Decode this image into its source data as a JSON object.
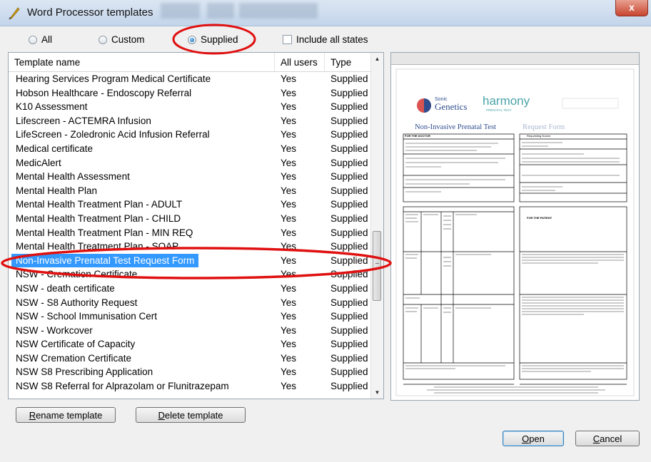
{
  "window": {
    "title": "Word Processor templates",
    "close_glyph": "x"
  },
  "filters": {
    "options": [
      {
        "label": "All",
        "selected": false
      },
      {
        "label": "Custom",
        "selected": false
      },
      {
        "label": "Supplied",
        "selected": true
      }
    ],
    "include_all_states": {
      "label": "Include all states",
      "checked": false
    }
  },
  "table": {
    "columns": [
      "Template name",
      "All users",
      "Type"
    ],
    "rows": [
      {
        "name": "Hearing Services Program Medical Certificate",
        "all_users": "Yes",
        "type": "Supplied"
      },
      {
        "name": "Hobson Healthcare - Endoscopy Referral",
        "all_users": "Yes",
        "type": "Supplied"
      },
      {
        "name": "K10 Assessment",
        "all_users": "Yes",
        "type": "Supplied"
      },
      {
        "name": "Lifescreen - ACTEMRA Infusion",
        "all_users": "Yes",
        "type": "Supplied"
      },
      {
        "name": "LifeScreen - Zoledronic Acid Infusion Referral",
        "all_users": "Yes",
        "type": "Supplied"
      },
      {
        "name": "Medical certificate",
        "all_users": "Yes",
        "type": "Supplied"
      },
      {
        "name": "MedicAlert",
        "all_users": "Yes",
        "type": "Supplied"
      },
      {
        "name": "Mental Health Assessment",
        "all_users": "Yes",
        "type": "Supplied"
      },
      {
        "name": "Mental Health Plan",
        "all_users": "Yes",
        "type": "Supplied"
      },
      {
        "name": "Mental Health Treatment Plan - ADULT",
        "all_users": "Yes",
        "type": "Supplied"
      },
      {
        "name": "Mental Health Treatment Plan - CHILD",
        "all_users": "Yes",
        "type": "Supplied"
      },
      {
        "name": "Mental Health Treatment Plan - MIN REQ",
        "all_users": "Yes",
        "type": "Supplied"
      },
      {
        "name": "Mental Health Treatment Plan - SOAP",
        "all_users": "Yes",
        "type": "Supplied"
      },
      {
        "name": "Non-Invasive Prenatal Test Request Form",
        "all_users": "Yes",
        "type": "Supplied",
        "selected": true
      },
      {
        "name": "NSW - Cremation Certificate",
        "all_users": "Yes",
        "type": "Supplied"
      },
      {
        "name": "NSW - death certificate",
        "all_users": "Yes",
        "type": "Supplied"
      },
      {
        "name": "NSW - S8 Authority Request",
        "all_users": "Yes",
        "type": "Supplied"
      },
      {
        "name": "NSW - School Immunisation Cert",
        "all_users": "Yes",
        "type": "Supplied"
      },
      {
        "name": "NSW - Workcover",
        "all_users": "Yes",
        "type": "Supplied"
      },
      {
        "name": "NSW Certificate of Capacity",
        "all_users": "Yes",
        "type": "Supplied"
      },
      {
        "name": "NSW Cremation Certificate",
        "all_users": "Yes",
        "type": "Supplied"
      },
      {
        "name": "NSW S8 Prescribing Application",
        "all_users": "Yes",
        "type": "Supplied"
      },
      {
        "name": "NSW S8 Referral for Alprazolam or Flunitrazepam",
        "all_users": "Yes",
        "type": "Supplied"
      }
    ]
  },
  "preview": {
    "brand_sonic_line1": "Sonic",
    "brand_sonic_line2": "Genetics",
    "brand_harmony": "harmony",
    "brand_harmony_sub": "PRENATAL TEST",
    "form_title": "Non-Invasive Prenatal Test",
    "form_title_suffix": "Request Form",
    "section_doctor": "FOR THE DOCTOR",
    "section_referring": "Requesting Doctor",
    "section_patient": "FOR THE PATIENT"
  },
  "buttons": {
    "rename": {
      "u": "R",
      "rest": "ename template"
    },
    "delete": {
      "u": "D",
      "rest": "elete template"
    },
    "open": {
      "u": "O",
      "rest": "pen"
    },
    "cancel": {
      "u": "C",
      "rest": "ancel"
    }
  },
  "icons": {
    "title": "quill-pen-icon",
    "close": "close-icon",
    "scroll_up": "scroll-up-icon",
    "scroll_down": "scroll-down-icon"
  },
  "colors": {
    "selection": "#3399ff",
    "annotation": "#e01010",
    "close_button": "#c8452f"
  }
}
